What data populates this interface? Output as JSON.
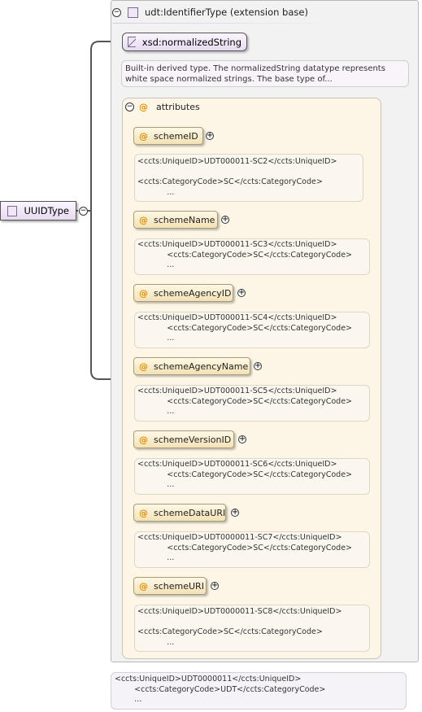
{
  "root_type": {
    "label": "UUIDType"
  },
  "extension": {
    "title": "udt:IdentifierType (extension base)"
  },
  "base_type": {
    "label": "xsd:normalizedString",
    "documentation": "Built-in derived type. The normalizedString datatype represents white space normalized strings. The base type of..."
  },
  "attributes_group": {
    "label": "attributes"
  },
  "attributes": [
    {
      "name": "schemeID",
      "doc": "<ccts:UniqueID>UDT000011-SC2</ccts:UniqueID>\n\n<ccts:CategoryCode>SC</ccts:CategoryCode>\n            ..."
    },
    {
      "name": "schemeName",
      "doc": "<ccts:UniqueID>UDT000011-SC3</ccts:UniqueID>\n            <ccts:CategoryCode>SC</ccts:CategoryCode>\n            ..."
    },
    {
      "name": "schemeAgencyID",
      "doc": "<ccts:UniqueID>UDT000011-SC4</ccts:UniqueID>\n            <ccts:CategoryCode>SC</ccts:CategoryCode>\n            ..."
    },
    {
      "name": "schemeAgencyName",
      "doc": "<ccts:UniqueID>UDT000011-SC5</ccts:UniqueID>\n            <ccts:CategoryCode>SC</ccts:CategoryCode>\n            ..."
    },
    {
      "name": "schemeVersionID",
      "doc": "<ccts:UniqueID>UDT000011-SC6</ccts:UniqueID>\n            <ccts:CategoryCode>SC</ccts:CategoryCode>\n            ..."
    },
    {
      "name": "schemeDataURI",
      "doc": "<ccts:UniqueID>UDT0000011-SC7</ccts:UniqueID>\n            <ccts:CategoryCode>SC</ccts:CategoryCode>\n            ..."
    },
    {
      "name": "schemeURI",
      "doc": "<ccts:UniqueID>UDT0000011-SC8</ccts:UniqueID>\n\n<ccts:CategoryCode>SC</ccts:CategoryCode>\n            ..."
    }
  ],
  "root_documentation": "<ccts:UniqueID>UDT0000011</ccts:UniqueID>\n        <ccts:CategoryCode>UDT</ccts:CategoryCode>\n        ...",
  "symbols": {
    "collapse": "−",
    "expand": "+",
    "attribute_marker": "@"
  },
  "colors": {
    "attribute_marker": "#e09000",
    "type_fill": "#f0e6f7",
    "attributes_fill": "#fdf6e6"
  }
}
